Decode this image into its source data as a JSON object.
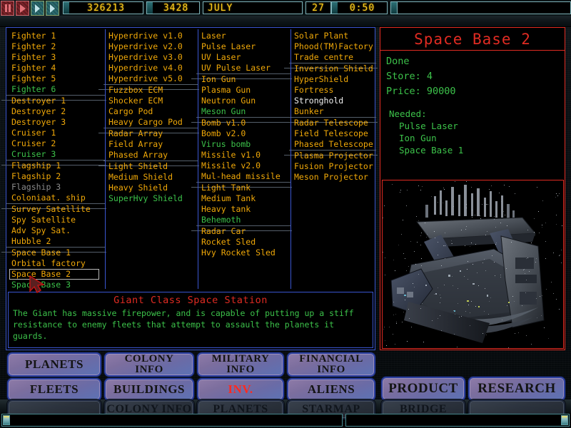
{
  "topbar": {
    "controls": [
      {
        "name": "pause-button",
        "icon": "pause-icon"
      },
      {
        "name": "play-button",
        "icon": "play-icon"
      },
      {
        "name": "fast-forward-button",
        "icon": "fast-forward-icon"
      },
      {
        "name": "fast-forward-2-button",
        "icon": "fast-forward-icon"
      }
    ],
    "credits": "326213",
    "year": "3428",
    "month": "JULY",
    "day": "27",
    "time": "0:50",
    "spare": ""
  },
  "inventory": {
    "columns": [
      {
        "name": "ships-column",
        "groups": [
          {
            "items": [
              {
                "label": "Fighter 1",
                "state": "available"
              },
              {
                "label": "Fighter 2",
                "state": "available"
              },
              {
                "label": "Fighter 3",
                "state": "available"
              },
              {
                "label": "Fighter 4",
                "state": "available"
              },
              {
                "label": "Fighter 5",
                "state": "available"
              },
              {
                "label": "Fighter 6",
                "state": "researched"
              }
            ]
          },
          {
            "items": [
              {
                "label": "Destroyer 1",
                "state": "available"
              },
              {
                "label": "Destroyer 2",
                "state": "available"
              },
              {
                "label": "Destroyer 3",
                "state": "available"
              },
              {
                "label": "Cruiser 1",
                "state": "available"
              },
              {
                "label": "Cruiser 2",
                "state": "available"
              },
              {
                "label": "Cruiser 3",
                "state": "researched"
              }
            ]
          },
          {
            "items": [
              {
                "label": "Flagship 1",
                "state": "available"
              },
              {
                "label": "Flagship 2",
                "state": "available"
              },
              {
                "label": "Flagship 3",
                "state": "locked"
              },
              {
                "label": "Coloniaat. ship",
                "state": "available"
              }
            ]
          },
          {
            "items": [
              {
                "label": "Survey Satellite",
                "state": "available"
              },
              {
                "label": "Spy Satellite",
                "state": "available"
              },
              {
                "label": "Adv Spy Sat.",
                "state": "available"
              },
              {
                "label": "Hubble 2",
                "state": "available"
              }
            ]
          },
          {
            "items": [
              {
                "label": "Space Base 1",
                "state": "available"
              },
              {
                "label": "Orbital factory",
                "state": "available"
              },
              {
                "label": "Space Base 2",
                "state": "selected"
              },
              {
                "label": "Space Base 3",
                "state": "researched"
              }
            ]
          }
        ]
      },
      {
        "name": "systems-column",
        "groups": [
          {
            "items": [
              {
                "label": "Hyperdrive v1.0",
                "state": "available"
              },
              {
                "label": "Hyperdrive v2.0",
                "state": "available"
              },
              {
                "label": "Hyperdrive v3.0",
                "state": "available"
              },
              {
                "label": "Hyperdrive v4.0",
                "state": "available"
              },
              {
                "label": "Hyperdrive v5.0",
                "state": "available"
              }
            ]
          },
          {
            "items": [
              {
                "label": "Fuzzbox ECM",
                "state": "available"
              },
              {
                "label": "Shocker ECM",
                "state": "available"
              },
              {
                "label": "Cargo Pod",
                "state": "available"
              },
              {
                "label": "Heavy Cargo Pod",
                "state": "available"
              }
            ]
          },
          {
            "items": [
              {
                "label": "Radar Array",
                "state": "available"
              },
              {
                "label": "Field Array",
                "state": "available"
              },
              {
                "label": "Phased Array",
                "state": "available"
              }
            ]
          },
          {
            "items": [
              {
                "label": "Light Shield",
                "state": "available"
              },
              {
                "label": "Medium Shield",
                "state": "available"
              },
              {
                "label": "Heavy Shield",
                "state": "available"
              },
              {
                "label": "SuperHvy Shield",
                "state": "researched"
              }
            ]
          }
        ]
      },
      {
        "name": "weapons-column",
        "groups": [
          {
            "items": [
              {
                "label": "Laser",
                "state": "available"
              },
              {
                "label": "Pulse Laser",
                "state": "available"
              },
              {
                "label": "UV Laser",
                "state": "available"
              },
              {
                "label": "UV Pulse Laser",
                "state": "available"
              }
            ]
          },
          {
            "items": [
              {
                "label": "Ion Gun",
                "state": "available"
              },
              {
                "label": "Plasma Gun",
                "state": "available"
              },
              {
                "label": "Neutron Gun",
                "state": "available"
              },
              {
                "label": "Meson Gun",
                "state": "researched"
              }
            ]
          },
          {
            "items": [
              {
                "label": "Bomb v1.0",
                "state": "available"
              },
              {
                "label": "Bomb v2.0",
                "state": "available"
              },
              {
                "label": "Virus bomb",
                "state": "researched"
              },
              {
                "label": "Missile v1.0",
                "state": "available"
              },
              {
                "label": "Missile v2.0",
                "state": "available"
              },
              {
                "label": "Mul-head missile",
                "state": "available"
              }
            ]
          },
          {
            "items": [
              {
                "label": "Light Tank",
                "state": "available"
              },
              {
                "label": "Medium Tank",
                "state": "available"
              },
              {
                "label": "Heavy tank",
                "state": "available"
              },
              {
                "label": "Behemoth",
                "state": "researched"
              }
            ]
          },
          {
            "items": [
              {
                "label": "Radar Car",
                "state": "available"
              },
              {
                "label": "Rocket Sled",
                "state": "available"
              },
              {
                "label": "Hvy Rocket Sled",
                "state": "available"
              }
            ]
          }
        ]
      },
      {
        "name": "buildings-column",
        "groups": [
          {
            "items": [
              {
                "label": "Solar Plant",
                "state": "available"
              },
              {
                "label": "Phood(TM)Factory",
                "state": "available"
              },
              {
                "label": "Trade centre",
                "state": "available"
              }
            ]
          },
          {
            "items": [
              {
                "label": "Inversion Shield",
                "state": "available"
              },
              {
                "label": "HyperShield",
                "state": "available"
              },
              {
                "label": "Fortress",
                "state": "available"
              },
              {
                "label": "Stronghold",
                "state": "highlighted"
              },
              {
                "label": "Bunker",
                "state": "available"
              }
            ]
          },
          {
            "items": [
              {
                "label": "Radar Telescope",
                "state": "available"
              },
              {
                "label": "Field Telescope",
                "state": "available"
              },
              {
                "label": "Phased Telescope",
                "state": "available"
              }
            ]
          },
          {
            "items": [
              {
                "label": "Plasma Projector",
                "state": "available"
              },
              {
                "label": "Fusion Projector",
                "state": "available"
              },
              {
                "label": "Meson Projector",
                "state": "available"
              }
            ]
          }
        ]
      }
    ]
  },
  "description": {
    "title": "Giant Class Space Station",
    "body": "The Giant has massive firepower, and is capable of putting up a stiff resistance to enemy fleets that attempt to assault the planets it guards."
  },
  "detail": {
    "title": "Space Base 2",
    "status": "Done",
    "store_label": "Store: 4",
    "price_label": "Price: 90000",
    "needed_label": "Needed:",
    "needed": [
      "Pulse Laser",
      "Ion Gun",
      "Space Base 1"
    ],
    "image_name": "space-station-render"
  },
  "nav": {
    "planets": "PLANETS",
    "colony_info": "COLONY\nINFO",
    "military_info": "MILITARY\nINFO",
    "financial_info": "FINANCIAL\nINFO",
    "fleets": "FLEETS",
    "buildings": "BUILDINGS",
    "inv": "INV.",
    "aliens": "ALIENS",
    "product": "PRODUCT",
    "research": "RESEARCH"
  },
  "nav_clipped": {
    "b1": "",
    "b2": "COLONY INFO",
    "b3": "PLANETS",
    "b4": "STARMAP",
    "b5": "BRIDGE",
    "b6": ""
  },
  "messages": {
    "left": "",
    "right": ""
  },
  "colors": {
    "accent_orange": "#f0a808",
    "accent_green": "#3cc24a",
    "accent_red": "#e02b22",
    "accent_blue": "#3a56d0",
    "lcd_yellow": "#ffcf1f"
  }
}
